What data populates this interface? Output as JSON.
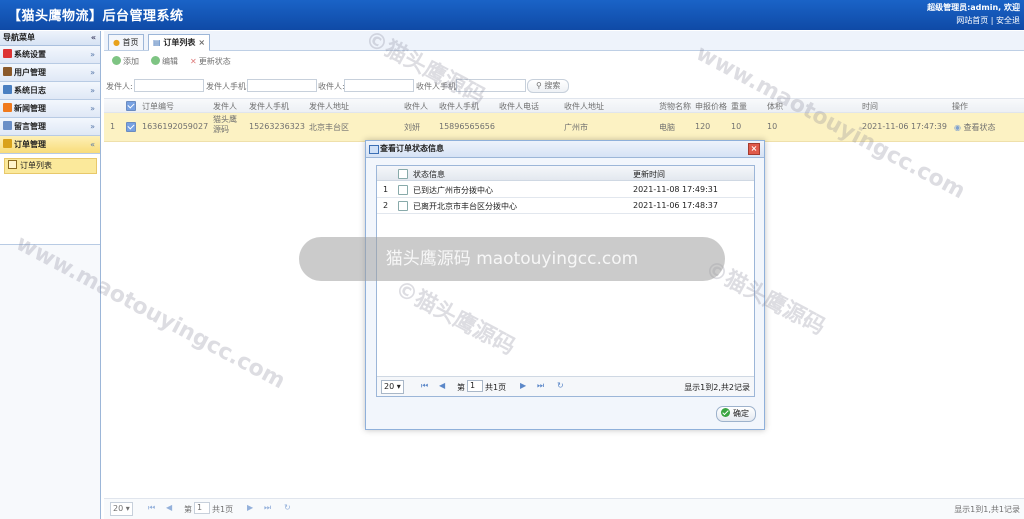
{
  "header": {
    "title": "【猫头鹰物流】后台管理系统",
    "user": "超级管理员:admin, 欢迎",
    "links": [
      "网站首页",
      "安全退"
    ]
  },
  "sidebar": {
    "title": "导航菜单",
    "items": [
      {
        "label": "系统设置",
        "icon": "tools-icon",
        "color": "#d33"
      },
      {
        "label": "用户管理",
        "icon": "user-icon",
        "color": "#8b5a2b"
      },
      {
        "label": "系统日志",
        "icon": "log-icon",
        "color": "#4a7fc1"
      },
      {
        "label": "新闻管理",
        "icon": "rss-icon",
        "color": "#f07a1e"
      },
      {
        "label": "留言管理",
        "icon": "message-icon",
        "color": "#6a8fc7"
      },
      {
        "label": "订单管理",
        "icon": "folder-icon",
        "color": "#d9a21b"
      }
    ],
    "subitem": "订单列表"
  },
  "tabs": [
    {
      "label": "首页"
    },
    {
      "label": "订单列表"
    }
  ],
  "toolbar": {
    "add": "添加",
    "edit": "编辑",
    "update": "更新状态"
  },
  "search": {
    "labels": [
      "发件人:",
      "发件人手机:",
      "收件人:",
      "收件人手机:"
    ],
    "button": "搜索"
  },
  "grid": {
    "headers": [
      "订单编号",
      "发件人",
      "发件人手机",
      "发件人地址",
      "收件人",
      "收件人手机",
      "收件人电话",
      "收件人地址",
      "货物名称",
      "申报价格",
      "重量",
      "体积",
      "时间",
      "操作"
    ],
    "row": {
      "index": "1",
      "order_no": "1636192059027",
      "sender": "猫头鹰源码",
      "sender_phone": "15263236323",
      "sender_addr": "北京丰台区",
      "receiver": "刘妍",
      "receiver_phone": "15896565656",
      "receiver_tel": "",
      "receiver_addr": "广州市",
      "goods": "电脑",
      "price": "120",
      "weight": "10",
      "volume": "10",
      "time": "2021-11-06 17:47:39",
      "action": "查看状态"
    }
  },
  "pager": {
    "size": "20",
    "page_label": "第",
    "page": "1",
    "total_pages": "共1页",
    "info": "显示1到1,共1记录"
  },
  "dialog": {
    "title": "查看订单状态信息",
    "headers": [
      "状态信息",
      "更新时间"
    ],
    "rows": [
      {
        "index": "1",
        "status": "已到达广州市分拨中心",
        "time": "2021-11-08 17:49:31"
      },
      {
        "index": "2",
        "status": "已离开北京市丰台区分拨中心",
        "time": "2021-11-06 17:48:37"
      }
    ],
    "pager": {
      "size": "20",
      "page_label": "第",
      "page": "1",
      "total_pages": "共1页",
      "info": "显示1到2,共2记录"
    },
    "ok": "确定"
  },
  "watermark": {
    "center": "猫头鹰源码 maotouyingcc.com",
    "tiles": [
      "©猫头鹰源码",
      "www.maotouyingcc.com"
    ]
  }
}
